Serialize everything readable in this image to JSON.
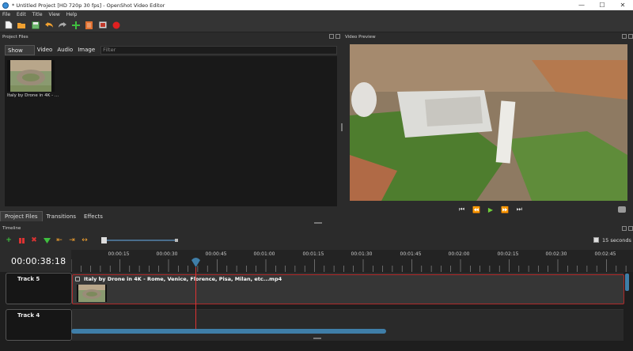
{
  "window": {
    "title": "* Untitled Project [HD 720p 30 fps] - OpenShot Video Editor"
  },
  "menu": [
    "File",
    "Edit",
    "Title",
    "View",
    "Help"
  ],
  "toolbar": {
    "icons": [
      "new-project-icon",
      "open-project-icon",
      "save-project-icon",
      "undo-icon",
      "redo-icon",
      "import-files-icon",
      "profile-icon",
      "fullscreen-icon",
      "export-video-icon"
    ]
  },
  "project_files": {
    "title": "Project Files",
    "tabs": [
      "Show All",
      "Video",
      "Audio",
      "Image"
    ],
    "active_tab": "Show All",
    "filter_placeholder": "Filter",
    "files": [
      {
        "name": "Italy by Drone in 4K - ..."
      }
    ]
  },
  "bottom_tabs": [
    "Project Files",
    "Transitions",
    "Effects"
  ],
  "video_preview": {
    "title": "Video Preview",
    "controls": [
      "jump-start-icon",
      "rewind-icon",
      "play-icon",
      "fast-forward-icon",
      "jump-end-icon"
    ]
  },
  "timeline": {
    "title": "Timeline",
    "scale_label": "15 seconds",
    "timecode": "00:00:38:18",
    "ticks": [
      "00:00:15",
      "00:00:30",
      "00:00:45",
      "00:01:00",
      "00:01:15",
      "00:01:30",
      "00:01:45",
      "00:02:00",
      "00:02:15",
      "00:02:30",
      "00:02:45"
    ],
    "tracks": [
      {
        "name": "Track 5",
        "clip": "Italy by Drone in 4K - Rome, Venice, Florence, Pisa, Milan, etc...mp4"
      },
      {
        "name": "Track 4"
      }
    ]
  },
  "colors": {
    "accent_blue": "#3f7ea8",
    "playhead_red": "#d33333",
    "record_red": "#e02020",
    "add_green": "#3fbf3f"
  }
}
